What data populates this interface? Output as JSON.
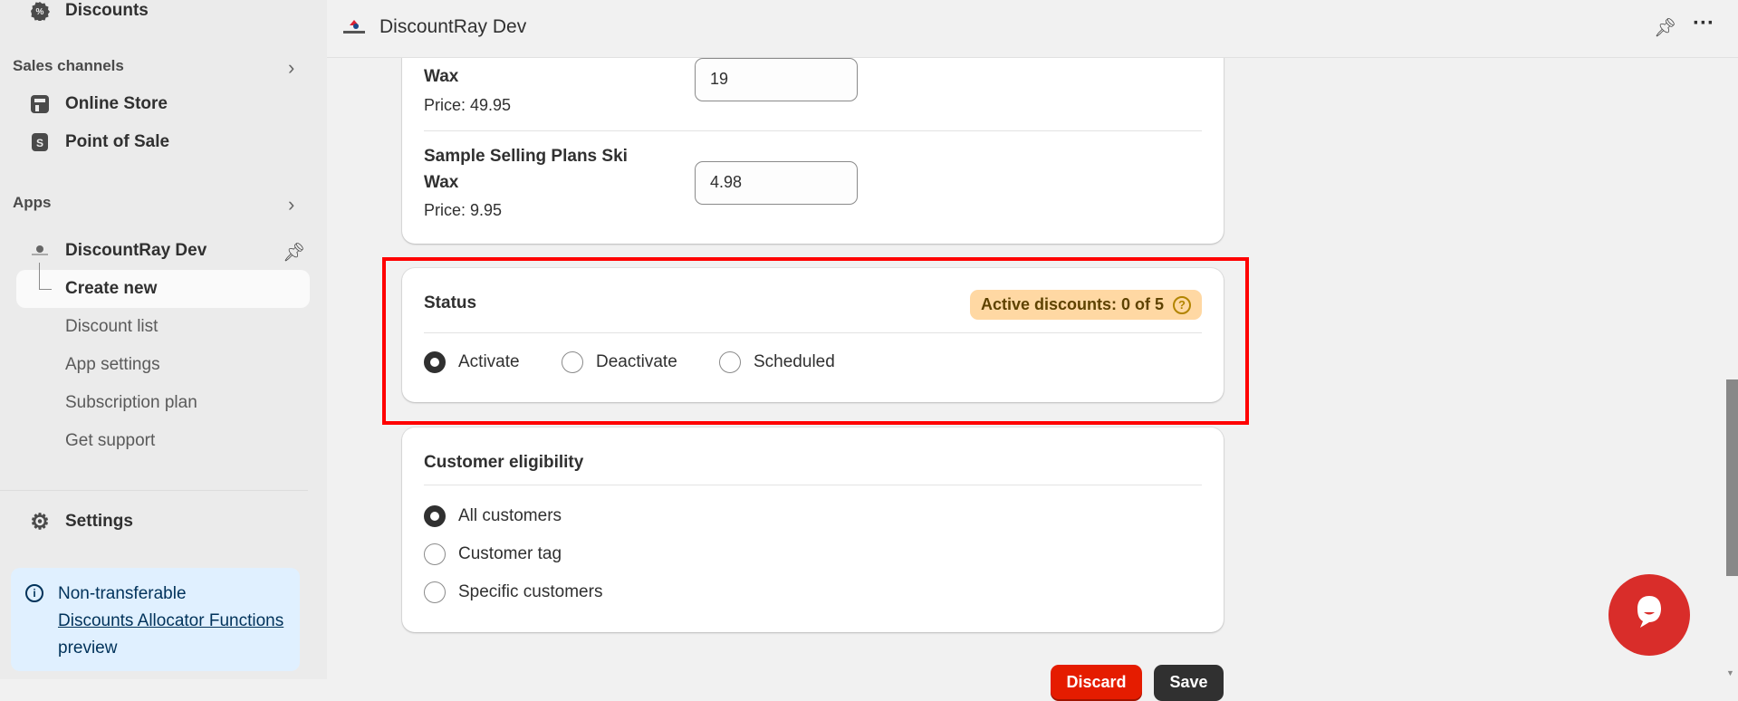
{
  "sidebar": {
    "discounts": "Discounts",
    "sales_channels": "Sales channels",
    "online_store": "Online Store",
    "point_of_sale": "Point of Sale",
    "apps": "Apps",
    "app_name": "DiscountRay Dev",
    "app_items": [
      "Create new",
      "Discount list",
      "App settings",
      "Subscription plan",
      "Get support"
    ],
    "settings": "Settings",
    "notice": {
      "line1": "Non-transferable",
      "link": "Discounts Allocator Functions",
      "suffix": " preview"
    }
  },
  "topbar": {
    "title": "DiscountRay Dev"
  },
  "products": [
    {
      "name_line2": "Wax",
      "price": "Price: 49.95",
      "value": "19"
    },
    {
      "name_line1": "Sample Selling Plans Ski",
      "name_line2": "Wax",
      "price": "Price: 9.95",
      "value": "4.98"
    }
  ],
  "status": {
    "title": "Status",
    "badge": "Active discounts: 0 of 5",
    "options": [
      "Activate",
      "Deactivate",
      "Scheduled"
    ],
    "selected": "Activate"
  },
  "eligibility": {
    "title": "Customer eligibility",
    "options": [
      "All customers",
      "Customer tag",
      "Specific customers"
    ],
    "selected": "All customers"
  },
  "footer": {
    "discard": "Discard",
    "save": "Save"
  },
  "colors": {
    "highlight": "#ff0000",
    "badge_bg": "#ffd8a3",
    "chat": "#d92d2a",
    "discard": "#e51c00"
  }
}
